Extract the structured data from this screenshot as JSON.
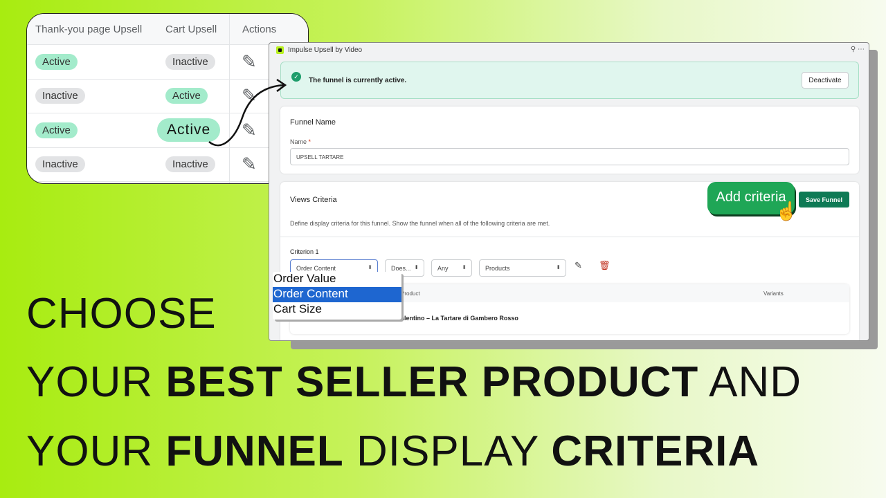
{
  "table": {
    "headers": [
      "Thank-you page Upsell",
      "Cart Upsell",
      "Actions"
    ],
    "rows": [
      [
        "Active",
        "Inactive"
      ],
      [
        "Inactive",
        "Active"
      ],
      [
        "Active",
        "Active"
      ],
      [
        "Inactive",
        "Inactive"
      ]
    ],
    "action_icon": "pencil-icon"
  },
  "window": {
    "title": "Impulse Upsell by Video",
    "banner": {
      "text": "The funnel is currently active.",
      "button": "Deactivate"
    },
    "funnel_name": {
      "title": "Funnel Name",
      "label": "Name",
      "required": "*",
      "value": "UPSELL TARTARE"
    },
    "views": {
      "title": "Views Criteria",
      "description": "Define display criteria for this funnel. Show the funnel when all of the following criteria are met.",
      "add_button": "Add criteria",
      "save_button": "Save Funnel",
      "criterion_label": "Criterion 1",
      "selects": [
        "Order Content",
        "Does...",
        "Any",
        "Products"
      ],
      "dropdown_options": [
        "Order Value",
        "Order Content",
        "Cart Size"
      ],
      "dropdown_selected": "Order Content",
      "product_table": {
        "headers": [
          "Product",
          "Variants"
        ],
        "row": "alentino – La Tartare di Gambero Rosso"
      }
    }
  },
  "headline": {
    "line1": "CHOOSE",
    "line2_a": "YOUR ",
    "line2_b": "BEST SELLER PRODUCT",
    "line2_c": " AND",
    "line3_a": "YOUR ",
    "line3_b": "FUNNEL",
    "line3_c": " DISPLAY ",
    "line3_d": "CRITERIA"
  },
  "colors": {
    "active": "#a3ebcb",
    "inactive": "#e2e3e5",
    "accent_green": "#1fa656",
    "save": "#0e7a55",
    "lime": "#a8ec10"
  }
}
